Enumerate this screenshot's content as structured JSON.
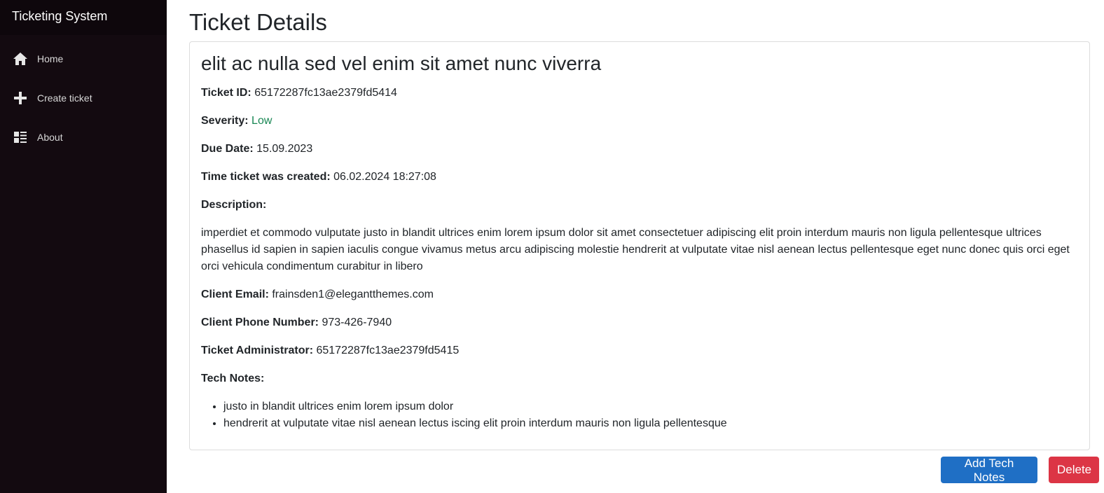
{
  "app": {
    "title": "Ticketing System"
  },
  "sidebar": {
    "items": [
      {
        "label": "Home",
        "icon": "home-icon"
      },
      {
        "label": "Create ticket",
        "icon": "plus-icon"
      },
      {
        "label": "About",
        "icon": "list-icon"
      }
    ]
  },
  "page": {
    "title": "Ticket Details"
  },
  "ticket": {
    "title": "elit ac nulla sed vel enim sit amet nunc viverra",
    "id_label": "Ticket ID:",
    "id": "65172287fc13ae2379fd5414",
    "severity_label": "Severity:",
    "severity": "Low",
    "severity_color": "#198754",
    "due_label": "Due Date:",
    "due": "15.09.2023",
    "created_label": "Time ticket was created:",
    "created": "06.02.2024 18:27:08",
    "description_label": "Description:",
    "description": "imperdiet et commodo vulputate justo in blandit ultrices enim lorem ipsum dolor sit amet consectetuer adipiscing elit proin interdum mauris non ligula pellentesque ultrices phasellus id sapien in sapien iaculis congue vivamus metus arcu adipiscing molestie hendrerit at vulputate vitae nisl aenean lectus pellentesque eget nunc donec quis orci eget orci vehicula condimentum curabitur in libero",
    "email_label": "Client Email:",
    "email": "frainsden1@elegantthemes.com",
    "phone_label": "Client Phone Number:",
    "phone": "973-426-7940",
    "admin_label": "Ticket Administrator:",
    "admin": "65172287fc13ae2379fd5415",
    "notes_label": "Tech Notes:",
    "notes": [
      "justo in blandit ultrices enim lorem ipsum dolor",
      "hendrerit at vulputate vitae nisl aenean lectus iscing elit proin interdum mauris non ligula pellentesque"
    ]
  },
  "actions": {
    "add_notes": "Add Tech Notes",
    "delete": "Delete",
    "primary_color": "#1f6fc5",
    "danger_color": "#dc3545"
  }
}
